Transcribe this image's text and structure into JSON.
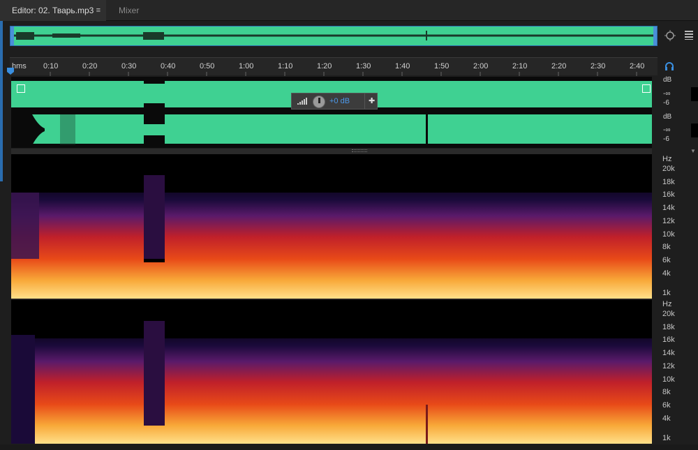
{
  "tabs": {
    "editor_label": "Editor: 02. Тварь.mp3",
    "mixer_label": "Mixer",
    "menu_glyph": "≡"
  },
  "ruler": {
    "unit_label": "hms",
    "ticks": [
      "0:10",
      "0:20",
      "0:30",
      "0:40",
      "0:50",
      "1:00",
      "1:10",
      "1:20",
      "1:30",
      "1:40",
      "1:50",
      "2:00",
      "2:10",
      "2:20",
      "2:30",
      "2:40"
    ]
  },
  "hud": {
    "volume_value": "+0 dB",
    "pin_glyph": "✚"
  },
  "meters": {
    "ch1": {
      "unit": "dB",
      "inf": "-∞",
      "minus6": "-6"
    },
    "ch2": {
      "unit": "dB",
      "inf": "-∞",
      "minus6": "-6"
    }
  },
  "spectral_axis": {
    "unit": "Hz",
    "labels": [
      "20k",
      "18k",
      "16k",
      "14k",
      "12k",
      "10k",
      "8k",
      "6k",
      "4k",
      "1k"
    ]
  },
  "icons": {
    "zoom": "magnify-zoom-icon",
    "menu": "panel-menu-icon",
    "headphones": "headphones-icon",
    "playhead": "playhead-marker-icon"
  },
  "colors": {
    "waveform": "#3fd192",
    "selection_blue": "#2a6db0",
    "hud_value": "#4c98e8"
  }
}
